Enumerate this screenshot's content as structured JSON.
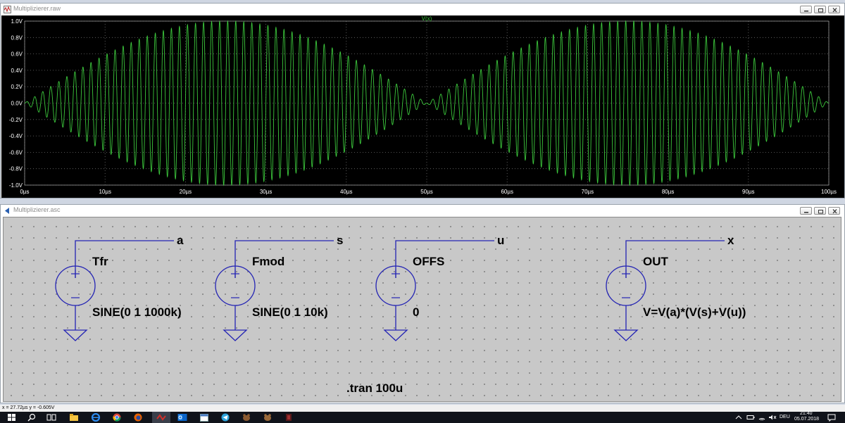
{
  "wave_window": {
    "title": "Multiplizierer.raw",
    "trace_label": "V(x)"
  },
  "schematic_window": {
    "title": "Multiplizierer.asc"
  },
  "chart_data": {
    "type": "line",
    "title": "V(x)",
    "xlabel": "",
    "ylabel": "",
    "xlim": [
      0,
      100
    ],
    "ylim": [
      -1.0,
      1.0
    ],
    "grid": true,
    "x_ticks": [
      "0µs",
      "10µs",
      "20µs",
      "30µs",
      "40µs",
      "50µs",
      "60µs",
      "70µs",
      "80µs",
      "90µs",
      "100µs"
    ],
    "y_ticks": [
      "1.0V",
      "0.8V",
      "0.6V",
      "0.4V",
      "0.2V",
      "0.0V",
      "-0.2V",
      "-0.4V",
      "-0.6V",
      "-0.8V",
      "-1.0V"
    ],
    "series": [
      {
        "name": "V(x)",
        "color": "#3cc83c",
        "expression": "sin(2*pi*1000k*t) * (sin(2*pi*10k*t) + 0)",
        "carrier_frequency_khz": 1000,
        "modulation_frequency_khz": 10,
        "peak_amplitude": 1.0
      }
    ]
  },
  "schematic": {
    "sources": [
      {
        "name": "Tfr",
        "value": "SINE(0 1 1000k)",
        "net": "a"
      },
      {
        "name": "Fmod",
        "value": "SINE(0 1 10k)",
        "net": "s"
      },
      {
        "name": "OFFS",
        "value": "0",
        "net": "u"
      },
      {
        "name": "OUT",
        "value": "V=V(a)*(V(s)+V(u))",
        "net": "x"
      }
    ],
    "directive": ".tran 100u",
    "wire_color": "#2424b4"
  },
  "status": {
    "cursor": "x = 27.72µs   y = -0.605V"
  },
  "taskbar": {
    "language": "DEU",
    "time": "21:40",
    "date": "05.07.2018",
    "icons": [
      "start-icon",
      "search-icon",
      "task-view-icon",
      "file-explorer-icon",
      "edge-icon",
      "chrome-icon",
      "firefox-icon",
      "ltspice-icon",
      "outlook-icon",
      "calendar-icon",
      "telegram-icon",
      "app-icon",
      "app-icon-2",
      "app-icon-3"
    ]
  }
}
